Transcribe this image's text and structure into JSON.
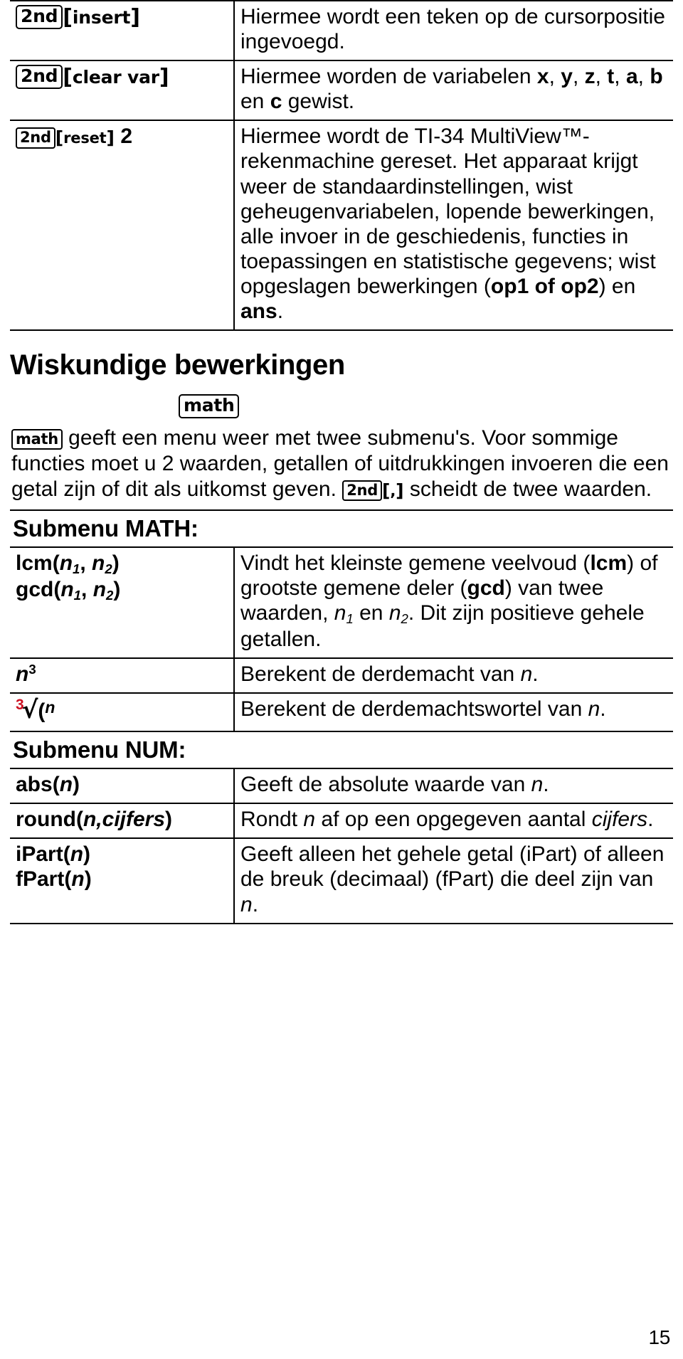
{
  "page_number": "15",
  "top_table": {
    "rows": [
      {
        "key": {
          "modifier": "2nd",
          "bracketed": "insert",
          "suffix": ""
        },
        "description_parts": [
          {
            "text": "Hiermee wordt een teken op de cursorpositie ingevoegd.",
            "style": "normal"
          }
        ]
      },
      {
        "key": {
          "modifier": "2nd",
          "bracketed": "clear var",
          "suffix": ""
        },
        "description_parts": [
          {
            "text": "Hiermee worden de variabelen ",
            "style": "normal"
          },
          {
            "text": "x",
            "style": "bold"
          },
          {
            "text": ", ",
            "style": "normal"
          },
          {
            "text": "y",
            "style": "bold"
          },
          {
            "text": ", ",
            "style": "normal"
          },
          {
            "text": "z",
            "style": "bold"
          },
          {
            "text": ", ",
            "style": "normal"
          },
          {
            "text": "t",
            "style": "bold"
          },
          {
            "text": ", ",
            "style": "normal"
          },
          {
            "text": "a",
            "style": "bold"
          },
          {
            "text": ", ",
            "style": "normal"
          },
          {
            "text": "b",
            "style": "bold"
          },
          {
            "text": " en ",
            "style": "normal"
          },
          {
            "text": "c",
            "style": "bold"
          },
          {
            "text": " gewist.",
            "style": "normal"
          }
        ]
      },
      {
        "key": {
          "modifier": "2nd",
          "bracketed": "reset",
          "suffix": "2"
        },
        "description_parts": [
          {
            "text": "Hiermee wordt de TI-34 MultiView™-rekenmachine gereset. Het apparaat krijgt weer de standaardinstellingen, wist geheugenvariabelen, lopende bewerkingen, alle invoer in de geschiedenis, functies in toepassingen en statistische gegevens; wist opgeslagen bewerkingen (",
            "style": "normal"
          },
          {
            "text": "op1 of op2",
            "style": "bold"
          },
          {
            "text": ") en ",
            "style": "normal"
          },
          {
            "text": "ans",
            "style": "bold"
          },
          {
            "text": ".",
            "style": "normal"
          }
        ]
      }
    ]
  },
  "section": {
    "title": "Wiskundige bewerkingen",
    "centered_key": "math",
    "intro_parts": [
      {
        "text": "math",
        "style": "key"
      },
      {
        "text": " geeft een menu weer met twee submenu's. Voor sommige functies moet u 2 waarden, getallen of uitdrukkingen invoeren die een getal zijn of dit als uitkomst geven. ",
        "style": "normal"
      },
      {
        "text": "2nd",
        "style": "key"
      },
      {
        "text": "[ , ]",
        "style": "bracket"
      },
      {
        "text": " scheidt de twee waarden.",
        "style": "normal"
      }
    ]
  },
  "submenu_math": {
    "heading": "Submenu MATH:",
    "rows": [
      {
        "key_lines": [
          "lcm(n1, n2)",
          "gcd(n1, n2)"
        ],
        "description": "Vindt het kleinste gemene veelvoud (lcm) of grootste gemene deler (gcd) van twee waarden, n1 en n2. Dit zijn positieve gehele getallen."
      },
      {
        "key_lines": [
          "n3"
        ],
        "description": "Berekent de derdemacht van n."
      },
      {
        "key_lines": [
          "3√(n"
        ],
        "description": "Berekent de derdemachtswortel van n."
      }
    ]
  },
  "submenu_num": {
    "heading": "Submenu NUM:",
    "rows": [
      {
        "key_lines": [
          "abs(n)"
        ],
        "description": "Geeft de absolute waarde van n."
      },
      {
        "key_lines": [
          "round(n,cijfers)"
        ],
        "description": "Rondt n af op een opgegeven aantal cijfers."
      },
      {
        "key_lines": [
          "iPart(n)",
          "fPart(n)"
        ],
        "description": "Geeft alleen het gehele getal (iPart) of alleen de breuk (decimaal) (fPart) die deel zijn van n."
      }
    ]
  },
  "labels": {
    "key_2nd": "2nd",
    "key_insert": "insert",
    "key_clear_var": "clear var",
    "key_reset": "reset",
    "key_reset_suffix": "2",
    "key_math": "math",
    "key_comma": ",",
    "lcm_name": "lcm",
    "gcd_name": "gcd",
    "n_var": "n",
    "sub1": "1",
    "sub2": "2",
    "cube_exp": "3",
    "abs_name": "abs",
    "round_name": "round",
    "round_arg": "n,cijfers",
    "ipart_name": "iPart",
    "fpart_name": "fPart"
  },
  "colors": {
    "text": "#000000",
    "rule": "#000000",
    "radical_index": "#cc1122",
    "background": "#ffffff"
  }
}
